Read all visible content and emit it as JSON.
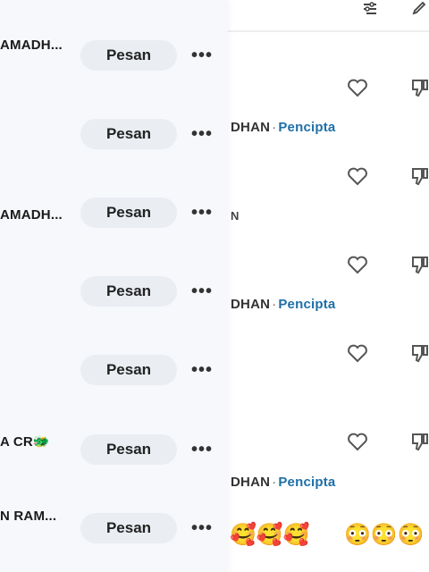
{
  "comments": {
    "creator_rows": [
      {
        "name_fragment": "DHAN",
        "separator": "·",
        "badge": "Pencipta"
      },
      {
        "name_fragment": "DHAN",
        "separator": "·",
        "badge": "Pencipta"
      },
      {
        "name_fragment": "DHAN",
        "separator": "·",
        "badge": "Pencipta"
      }
    ],
    "partial_text": "N",
    "emoji_group_1": "🥰🥰🥰",
    "emoji_group_2": "😳😳😳"
  },
  "panel": {
    "rows": [
      {
        "name": "AMADH...",
        "button_label": "Pesan",
        "more_label": "•••"
      },
      {
        "name": "",
        "button_label": "Pesan",
        "more_label": "•••"
      },
      {
        "name": "AMADH...",
        "button_label": "Pesan",
        "more_label": "•••"
      },
      {
        "name": "",
        "button_label": "Pesan",
        "more_label": "•••"
      },
      {
        "name": "",
        "button_label": "Pesan",
        "more_label": "•••"
      },
      {
        "name": "A CR🐲",
        "button_label": "Pesan",
        "more_label": "•••"
      },
      {
        "name": "N RAM...",
        "button_label": "Pesan",
        "more_label": "•••"
      }
    ]
  },
  "icons": {
    "top": [
      "filter-icon",
      "edit-icon"
    ],
    "like": "heart-icon",
    "dislike": "dislike-icon",
    "more": "more-horizontal-icon"
  }
}
